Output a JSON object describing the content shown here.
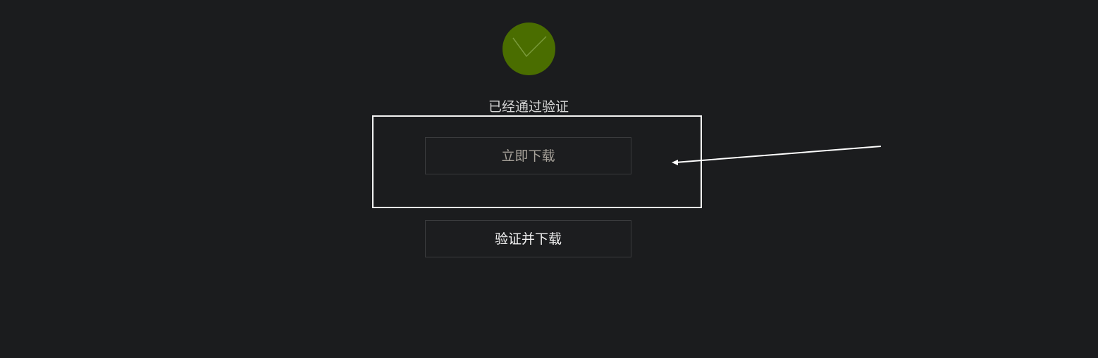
{
  "status": {
    "icon": "check-icon",
    "color": "#4a6d00",
    "text": "已经通过验证"
  },
  "actions": {
    "download_label": "立即下载",
    "verify_download_label": "验证并下载"
  },
  "annotation": {
    "highlight_color": "#f2f2f2",
    "arrow_color": "#ffffff"
  }
}
